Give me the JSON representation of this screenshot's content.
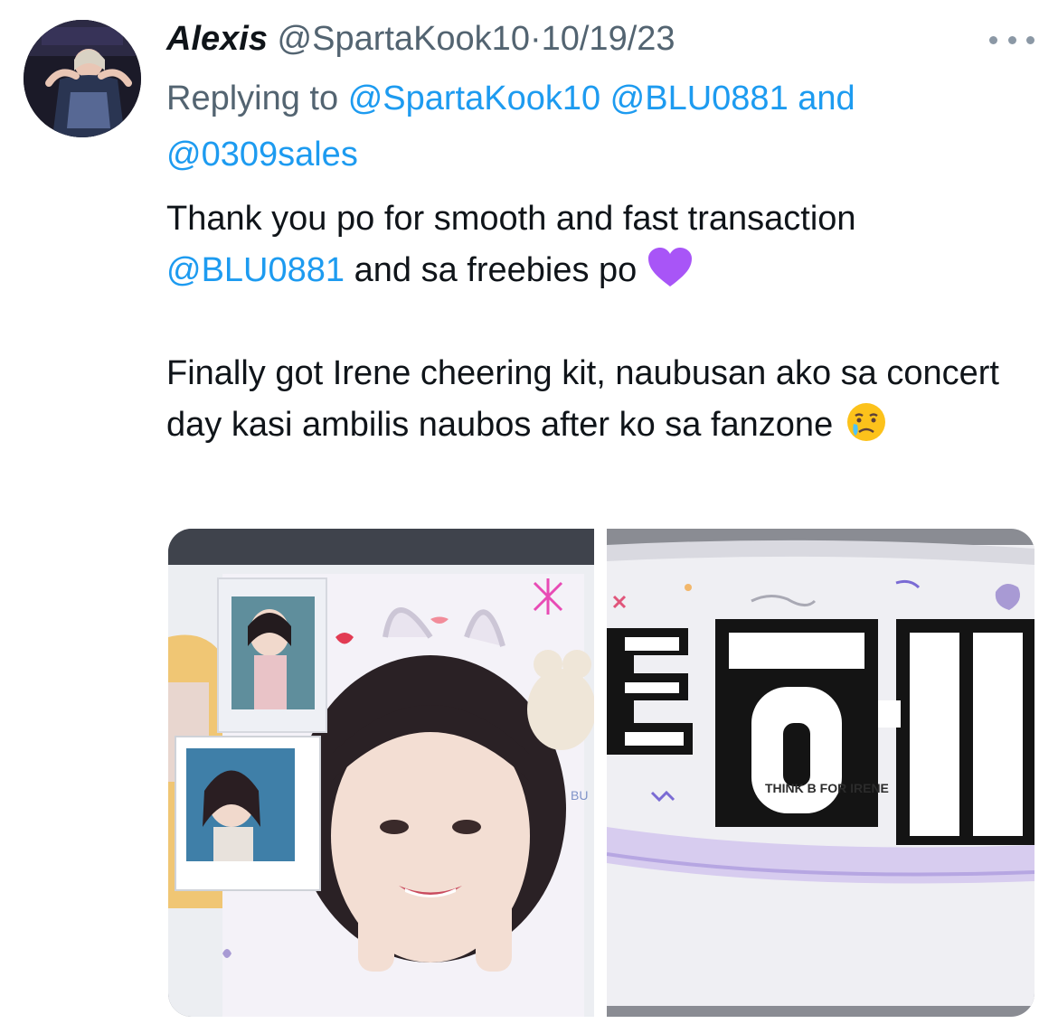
{
  "tweet": {
    "author_name": "Alexis",
    "handle": "@SpartaKook10",
    "separator": "·",
    "date": "10/19/23",
    "replying_prefix": "Replying to",
    "reply_mentions": [
      "@SpartaKook10",
      "@BLU0881",
      "@0309sales"
    ],
    "reply_and": "and",
    "line1": "Thank you po for smooth and fast transaction",
    "line2_mention": "@BLU0881",
    "line2_text": "and sa freebies po",
    "line2_emoji": "purple-heart-icon",
    "para2": "Finally got Irene cheering kit, naubusan ako sa concert day kasi ambilis naubos after ko sa fanzone",
    "para2_emoji": "crying-face-icon",
    "banner_caption": "THINK B FOR IRENE",
    "banner_fragment": "BU"
  },
  "colors": {
    "link": "#1d9bf0",
    "muted": "#536471",
    "text": "#0f1419",
    "heart": "#a855f7"
  }
}
